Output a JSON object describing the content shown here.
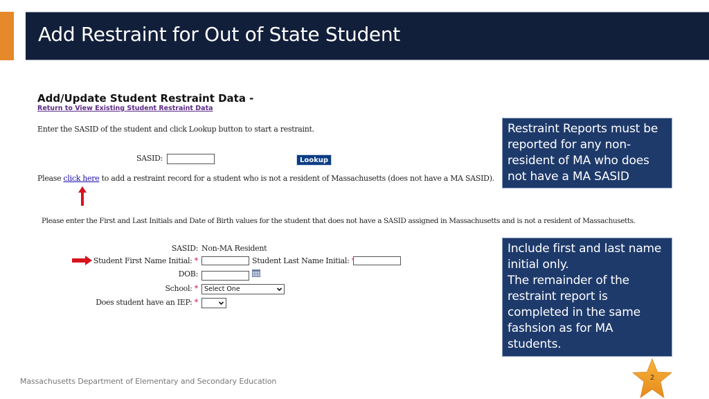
{
  "slide": {
    "title": "Add Restraint for Out of State Student",
    "footer": "Massachusetts Department of Elementary and Secondary Education",
    "page_number": "2",
    "colors": {
      "title_bar": "#121f3a",
      "accent": "#e5892a",
      "callout_bg": "#1e3a6b",
      "annotation_arrow": "#d7141e"
    }
  },
  "form": {
    "heading": "Add/Update Student Restraint Data -",
    "return_link": "Return to View Existing Student Restraint Data",
    "instruction_sasid": "Enter the SASID of the student and click Lookup button to start a restraint.",
    "sasid_label": "SASID:",
    "sasid_value": "",
    "lookup_button": "Lookup",
    "nonresident_prefix": "Please ",
    "nonresident_link": "click here",
    "nonresident_suffix": " to add a restraint record for a student who is not a resident of Massachusetts (does not have a MA SASID).",
    "instruction_initials": "Please enter the First and Last Initials and Date of Birth values for the student that does not have a SASID assigned in Massachusetts and is not a resident of Massachusetts.",
    "fields": {
      "sasid_label": "SASID:",
      "sasid_value": "Non-MA Resident",
      "first_initial_label": "Student First Name Initial:",
      "first_initial_value": "",
      "last_initial_label": "Student Last Name Initial:",
      "last_initial_value": "",
      "dob_label": "DOB:",
      "dob_value": "",
      "school_label": "School:",
      "school_selected": "Select One",
      "iep_label": "Does student have an IEP:",
      "iep_selected": "",
      "required_marker": "*"
    }
  },
  "callouts": [
    {
      "text": "Restraint Reports must be reported for any non-resident of MA who does not have a MA SASID"
    },
    {
      "lines": [
        "Include first and last name initial only.",
        "The remainder of the restraint report is completed in the same fashsion as for MA students."
      ]
    }
  ],
  "icons": {
    "up_arrow": "arrow-up-icon",
    "right_arrow": "arrow-right-icon",
    "calendar": "calendar-icon",
    "dropdown": "chevron-down-icon",
    "page_badge": "star-icon"
  }
}
